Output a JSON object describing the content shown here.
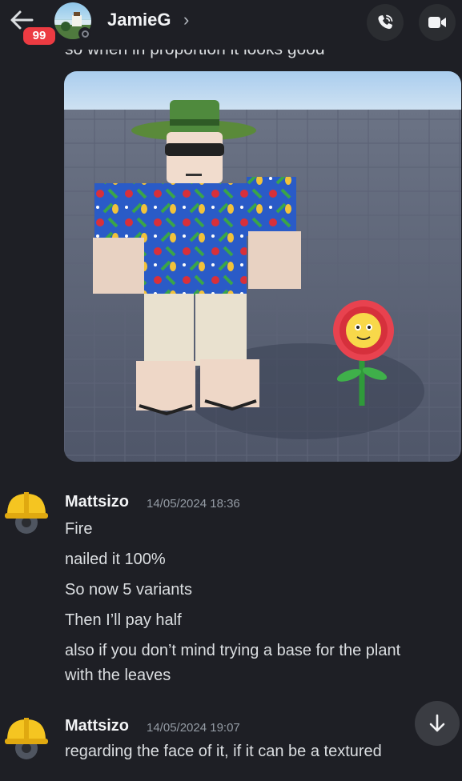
{
  "header": {
    "unread_count": "99",
    "channel_name": "JamieG",
    "chevron": "›",
    "icons": [
      "back-arrow-icon",
      "voice-call-icon",
      "video-call-icon"
    ]
  },
  "previous_message": {
    "cut_text": "so when in proportion it looks good"
  },
  "attachment": {
    "kind": "image",
    "description_icon": "roblox-avatar-render"
  },
  "messages": [
    {
      "author": "Mattsizo",
      "timestamp": "14/05/2024 18:36",
      "lines": [
        "Fire",
        "nailed it 100%",
        "So now 5 variants",
        "Then I’ll pay half",
        "also if you don’t mind trying a base for the plant",
        "with the leaves"
      ]
    },
    {
      "author": "Mattsizo",
      "timestamp": "14/05/2024 19:07",
      "lines": [
        "regarding the face of it, if it can be a textured"
      ]
    }
  ],
  "colors": {
    "background": "#1e1f25",
    "badge": "#ec3b42",
    "text": "#dbdee1",
    "muted": "#949ba4"
  }
}
